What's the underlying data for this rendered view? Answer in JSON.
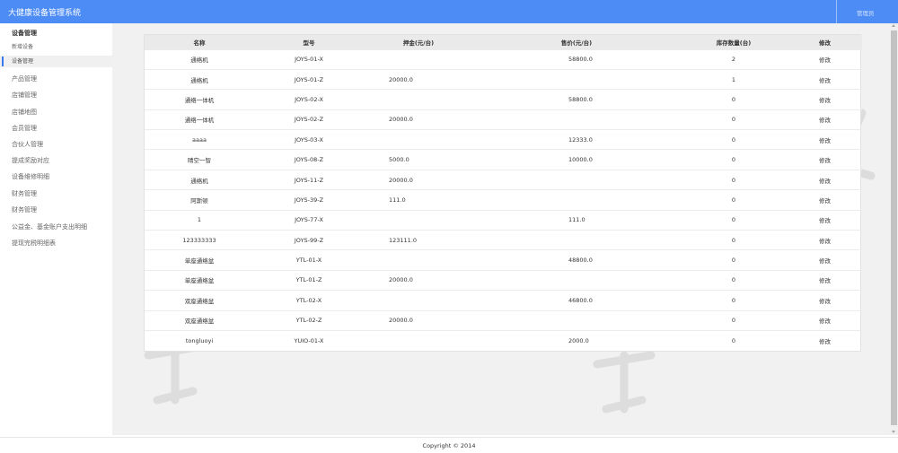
{
  "header": {
    "app_title": "大健康设备管理系统",
    "admin_label": "管理员"
  },
  "sidebar": {
    "group_title": "设备管理",
    "sub_items": [
      {
        "label": "新增设备",
        "active": false
      },
      {
        "label": "设备管理",
        "active": true
      }
    ],
    "items": [
      {
        "label": "产品管理"
      },
      {
        "label": "店铺管理"
      },
      {
        "label": "店铺地图"
      },
      {
        "label": "会员管理"
      },
      {
        "label": "合伙人管理"
      },
      {
        "label": "提成奖励对应"
      },
      {
        "label": "设备维修明细"
      },
      {
        "label": "财务管理"
      },
      {
        "label": "财务管理"
      },
      {
        "label": "公益金、基金账户支出明细"
      },
      {
        "label": "提现完税明细表"
      }
    ]
  },
  "table": {
    "headers": [
      "名称",
      "型号",
      "押金(元/台)",
      "售价(元/台)",
      "库存数量(台)",
      "修改"
    ],
    "rows": [
      {
        "name": "通络机",
        "model": "JOYS-01-X",
        "deposit": "",
        "price": "58800.0",
        "stock": "2",
        "action": "修改"
      },
      {
        "name": "通络机",
        "model": "JOYS-01-Z",
        "deposit": "20000.0",
        "price": "",
        "stock": "1",
        "action": "修改"
      },
      {
        "name": "通络一体机",
        "model": "JOYS-02-X",
        "deposit": "",
        "price": "58800.0",
        "stock": "0",
        "action": "修改"
      },
      {
        "name": "通络一体机",
        "model": "JOYS-02-Z",
        "deposit": "20000.0",
        "price": "",
        "stock": "0",
        "action": "修改"
      },
      {
        "name": "aaaa",
        "model": "JOYS-03-X",
        "deposit": "",
        "price": "12333.0",
        "stock": "0",
        "action": "修改"
      },
      {
        "name": "晴空一智",
        "model": "JOYS-08-Z",
        "deposit": "5000.0",
        "price": "10000.0",
        "stock": "0",
        "action": "修改"
      },
      {
        "name": "通络机",
        "model": "JOYS-11-Z",
        "deposit": "20000.0",
        "price": "",
        "stock": "0",
        "action": "修改"
      },
      {
        "name": "阿斯顿",
        "model": "JOYS-39-Z",
        "deposit": "111.0",
        "price": "",
        "stock": "0",
        "action": "修改"
      },
      {
        "name": "1",
        "model": "JOYS-77-X",
        "deposit": "",
        "price": "111.0",
        "stock": "0",
        "action": "修改"
      },
      {
        "name": "123333333",
        "model": "JOYS-99-Z",
        "deposit": "123111.0",
        "price": "",
        "stock": "0",
        "action": "修改"
      },
      {
        "name": "单座通络盆",
        "model": "YTL-01-X",
        "deposit": "",
        "price": "48800.0",
        "stock": "0",
        "action": "修改"
      },
      {
        "name": "单座通络盆",
        "model": "YTL-01-Z",
        "deposit": "20000.0",
        "price": "",
        "stock": "0",
        "action": "修改"
      },
      {
        "name": "双座通络盆",
        "model": "YTL-02-X",
        "deposit": "",
        "price": "46800.0",
        "stock": "0",
        "action": "修改"
      },
      {
        "name": "双座通络盆",
        "model": "YTL-02-Z",
        "deposit": "20000.0",
        "price": "",
        "stock": "0",
        "action": "修改"
      },
      {
        "name": "tongluoyi",
        "model": "YUIO-01-X",
        "deposit": "",
        "price": "2000.0",
        "stock": "0",
        "action": "修改"
      }
    ]
  },
  "footer": {
    "copyright": "Copyright © 2014"
  }
}
